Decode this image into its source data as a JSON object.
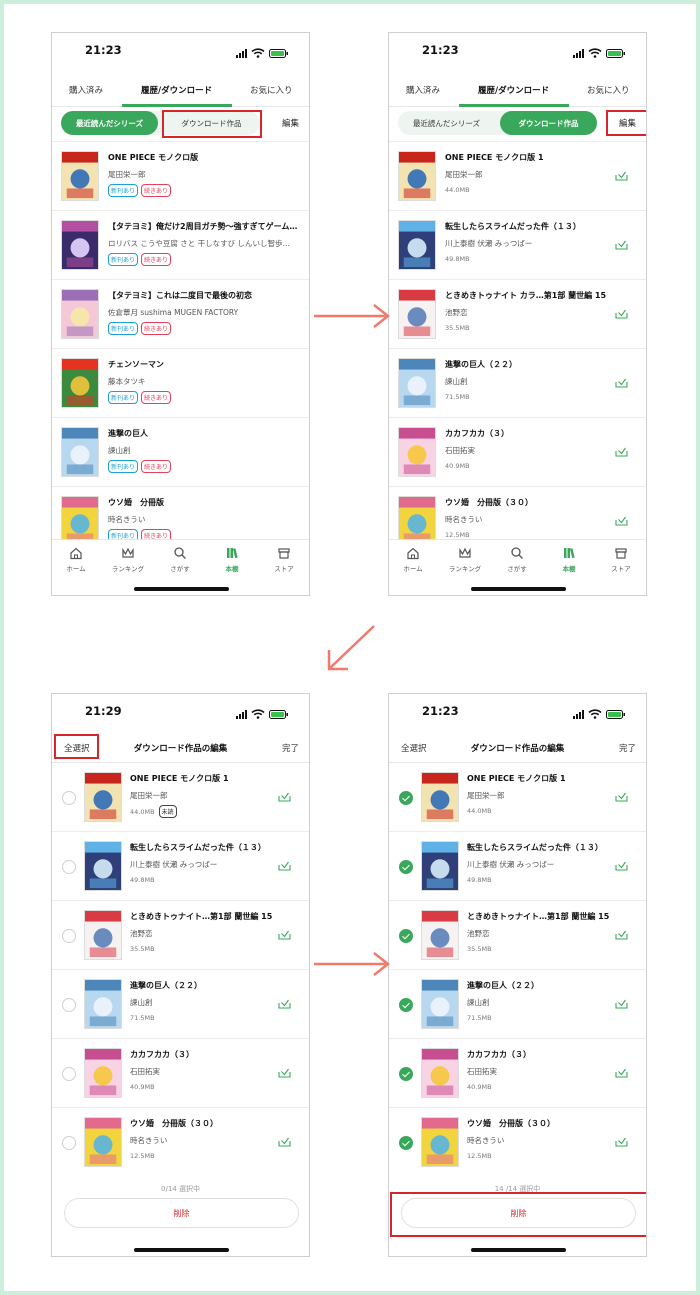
{
  "status": {
    "time1": "21:23",
    "time2": "21:29"
  },
  "tabs": {
    "purchased": "購入済み",
    "history": "履歴/ダウンロード",
    "favorites": "お気に入り"
  },
  "subtabs": {
    "recent": "最近読んだシリーズ",
    "downloads": "ダウンロード作品",
    "edit": "編集"
  },
  "nav": {
    "home": "ホーム",
    "ranking": "ランキング",
    "search": "さがす",
    "bookshelf": "本棚",
    "store": "ストア"
  },
  "badges": {
    "new": "新刊あり",
    "cont": "続きあり",
    "unread": "未読"
  },
  "recent_list": [
    {
      "title": "ONE PIECE モノクロ版",
      "author": "尾田栄一郎"
    },
    {
      "title": "【タテヨミ】俺だけ2周目ガチ勢〜強すぎてゲーム…",
      "author": "ロリバス こうや豆腐 さと 干しなすび しんいし智歩…"
    },
    {
      "title": "【タテヨミ】これは二度目で最後の初恋",
      "author": "佐倉蕈月 sushima MUGEN FACTORY"
    },
    {
      "title": "チェンソーマン",
      "author": "藤本タツキ"
    },
    {
      "title": "進撃の巨人",
      "author": "諫山創"
    },
    {
      "title": "ウソ婚　分冊版",
      "author": "時名きうい"
    }
  ],
  "download_list": [
    {
      "title": "ONE PIECE モノクロ版 1",
      "author": "尾田栄一郎",
      "size": "44.0MB"
    },
    {
      "title": "転生したらスライムだった件（１３）",
      "author": "川上泰樹 伏瀬 みっつばー",
      "size": "49.8MB"
    },
    {
      "title": "ときめきトゥナイト カラ…第1部 蘭世編 15",
      "author": "池野恋",
      "size": "35.5MB"
    },
    {
      "title": "進撃の巨人（２２）",
      "author": "諫山創",
      "size": "71.5MB"
    },
    {
      "title": "カカフカカ（３）",
      "author": "石田拓実",
      "size": "40.9MB"
    },
    {
      "title": "ウソ婚　分冊版（３０）",
      "author": "時名きうい",
      "size": "12.5MB"
    }
  ],
  "edit_list": [
    {
      "title": "ONE PIECE モノクロ版 1",
      "author": "尾田栄一郎",
      "size": "44.0MB"
    },
    {
      "title": "転生したらスライムだった件（１３）",
      "author": "川上泰樹 伏瀬 みっつばー",
      "size": "49.8MB"
    },
    {
      "title": "ときめきトゥナイト…第1部 蘭世編 15",
      "author": "池野恋",
      "size": "35.5MB"
    },
    {
      "title": "進撃の巨人（２２）",
      "author": "諫山創",
      "size": "71.5MB"
    },
    {
      "title": "カカフカカ（３）",
      "author": "石田拓実",
      "size": "40.9MB"
    },
    {
      "title": "ウソ婚　分冊版（３０）",
      "author": "時名きうい",
      "size": "12.5MB"
    }
  ],
  "edit": {
    "select_all": "全選択",
    "title": "ダウンロード作品の編集",
    "done": "完了",
    "delete": "削除",
    "count_none": "0/14 選択中",
    "count_all": "14 /14 選択中"
  },
  "colors": {
    "accent": "#3aa85c",
    "highlight": "#d6262c",
    "arrow": "#f07a6e",
    "background": "#cdeedb"
  }
}
